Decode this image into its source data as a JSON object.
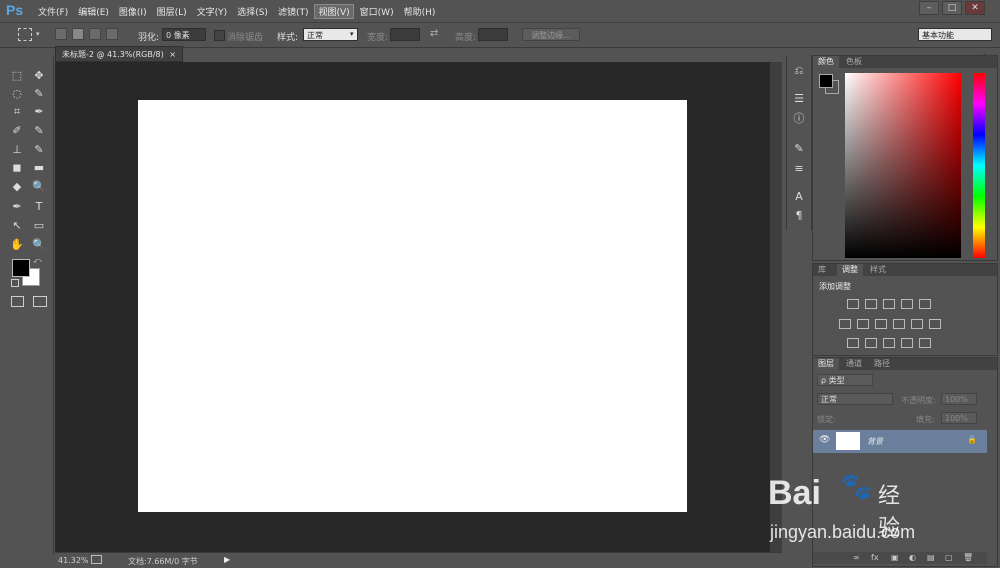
{
  "app": {
    "logo": "Ps",
    "menu": [
      "文件(F)",
      "编辑(E)",
      "图像(I)",
      "图层(L)",
      "文字(Y)",
      "选择(S)",
      "滤镜(T)",
      "视图(V)",
      "窗口(W)",
      "帮助(H)"
    ],
    "active_menu_index": 7,
    "window_buttons": [
      "–",
      "□",
      "✕"
    ]
  },
  "options": {
    "feather_label": "羽化:",
    "feather_value": "0 像素",
    "antialias_label": "消除锯齿",
    "style_label": "样式:",
    "style_value": "正常",
    "width_label": "宽度:",
    "height_label": "高度:",
    "refine_edge": "调整边缘...",
    "workspace": "基本功能"
  },
  "document": {
    "tab_title": "未标题-2 @ 41.3%(RGB/8)",
    "tab_close": "×"
  },
  "status": {
    "zoom": "41.32%",
    "doc_info": "文档:7.66M/0 字节"
  },
  "tools": [
    "⬚",
    "✥",
    "◌",
    "✎",
    "⌗",
    "✒",
    "✐",
    "✎",
    "⊥",
    "✎",
    "◼",
    "▬",
    "◆",
    "🔍",
    "✒",
    "T",
    "↖",
    "▭",
    "✋",
    "🔍"
  ],
  "color_panel": {
    "tabs": [
      "颜色",
      "色板"
    ],
    "foreground": "#000000",
    "background": "#ffffff",
    "hue_color": "#ff0000"
  },
  "adjust_panel": {
    "tabs": [
      "库",
      "调整",
      "样式"
    ],
    "title": "添加调整"
  },
  "layers_panel": {
    "tabs": [
      "图层",
      "通道",
      "路径"
    ],
    "filter_kind": "ρ 类型",
    "blend_mode": "正常",
    "opacity_label": "不透明度:",
    "opacity_value": "100%",
    "lock_label": "锁定:",
    "fill_label": "填充:",
    "fill_value": "100%",
    "layer_name": "背景",
    "footer_icons": [
      "∞",
      "fx",
      "▣",
      "◐",
      "▤",
      "▢",
      "🗑"
    ]
  },
  "watermark": {
    "brand": "Bai",
    "brand_cn": "经验",
    "url": "jingyan.baidu.com"
  }
}
